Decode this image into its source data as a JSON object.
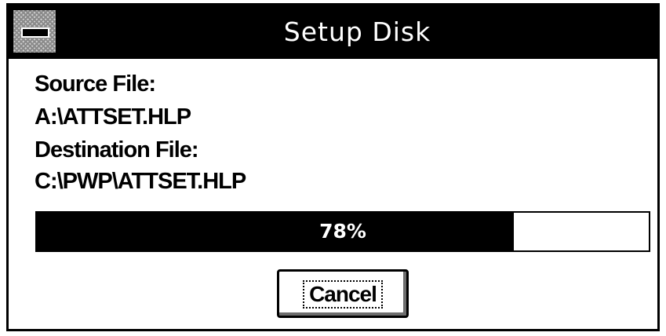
{
  "window": {
    "title": "Setup Disk",
    "system_menu_icon": "system-menu-icon"
  },
  "copy": {
    "source_label": "Source File:",
    "source_value": "A:\\ATTSET.HLP",
    "destination_label": "Destination File:",
    "destination_value": "C:\\PWP\\ATTSET.HLP"
  },
  "progress": {
    "percent": 78,
    "label": "78%"
  },
  "buttons": {
    "cancel_label": "Cancel"
  },
  "colors": {
    "titlebar": "#000000",
    "progress_fill": "#000000",
    "background": "#ffffff"
  }
}
